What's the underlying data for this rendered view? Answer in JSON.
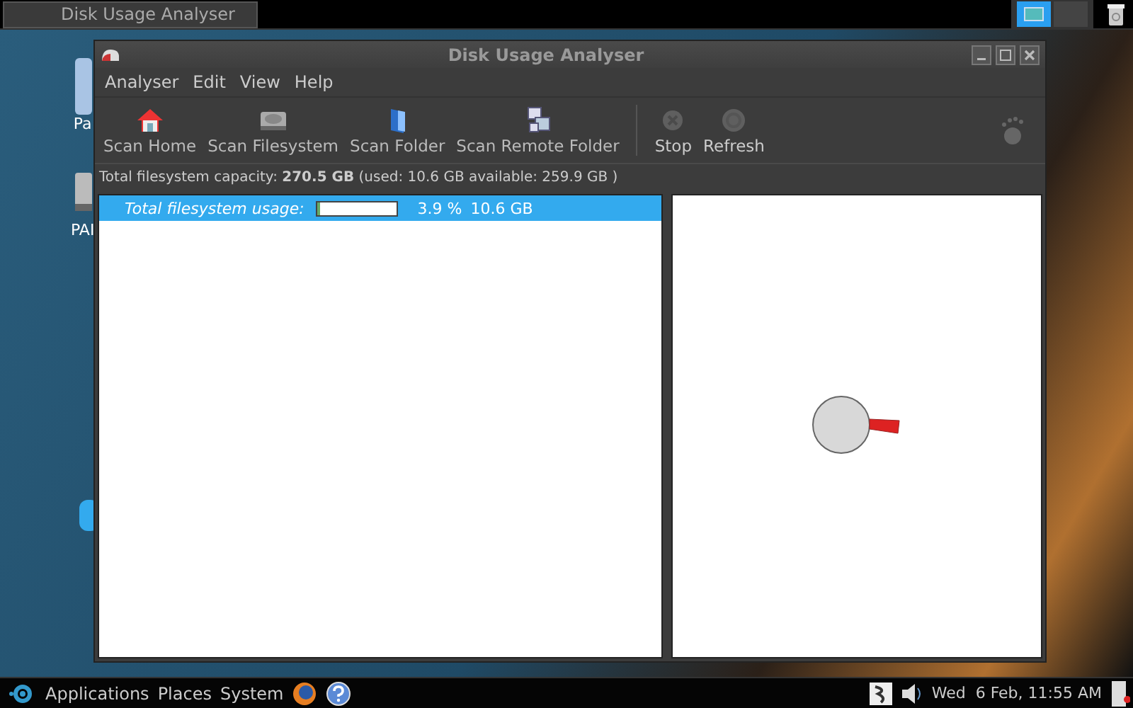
{
  "top_panel": {
    "tasks": [
      {
        "label": "Disk Usage Analyser",
        "selected": false
      }
    ],
    "workspaces": [
      {
        "selected": true
      },
      {
        "selected": false
      }
    ]
  },
  "desktop_icons": [
    {
      "label": "Pa"
    },
    {
      "label": "PAI"
    }
  ],
  "window": {
    "title": "Disk Usage Analyser",
    "menu": [
      {
        "label": "Analyser"
      },
      {
        "label": "Edit"
      },
      {
        "label": "View"
      },
      {
        "label": "Help"
      }
    ],
    "toolbar": [
      {
        "kind": "home",
        "label": "Scan Home",
        "disabled": false
      },
      {
        "kind": "disk",
        "label": "Scan Filesystem",
        "disabled": false
      },
      {
        "kind": "folder",
        "label": "Scan Folder",
        "disabled": false
      },
      {
        "kind": "remote",
        "label": "Scan Remote Folder",
        "disabled": false
      },
      {
        "kind": "separator"
      },
      {
        "kind": "stop",
        "label": "Stop",
        "disabled": true
      },
      {
        "kind": "refresh",
        "label": "Refresh",
        "disabled": true
      }
    ],
    "capacity": "Total filesystem capacity: **270.5 GB** (used: 10.6 GB available: 259.9 GB )",
    "rows": [
      {
        "label": "Total filesystem usage:",
        "level": 0.039,
        "percent": "3.9 %",
        "size": "10.6 GB",
        "selected": true
      }
    ]
  },
  "bottom_panel": {
    "menus": [
      {
        "label": "Applications"
      },
      {
        "label": "Places"
      },
      {
        "label": "System"
      }
    ],
    "clock": "Wed  6 Feb, 11:55 AM"
  }
}
